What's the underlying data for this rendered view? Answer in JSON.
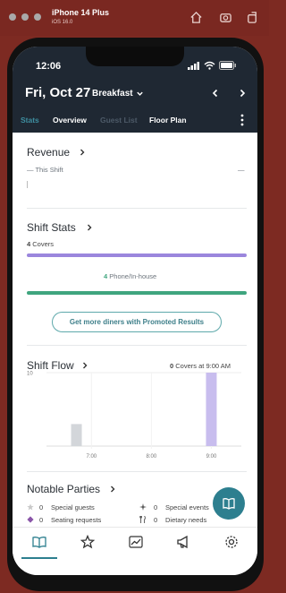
{
  "simulator": {
    "title": "iPhone 14 Plus",
    "subtitle": "iOS 16.0",
    "icons": [
      "home-icon",
      "screenshot-icon",
      "rotate-icon"
    ]
  },
  "status_bar": {
    "time": "12:06",
    "icons": [
      "signal-icon",
      "wifi-icon",
      "battery-icon"
    ]
  },
  "header": {
    "date": "Fri, Oct 27",
    "meal": "Breakfast",
    "prev_icon": "chevron-left-icon",
    "next_icon": "chevron-right-icon"
  },
  "tabs": [
    {
      "label": "Stats",
      "state": "active"
    },
    {
      "label": "Overview",
      "state": "normal"
    },
    {
      "label": "Guest List",
      "state": "dim"
    },
    {
      "label": "Floor Plan",
      "state": "normal"
    }
  ],
  "revenue": {
    "title": "Revenue",
    "legend": "— This Shift",
    "value": "—"
  },
  "shift_stats": {
    "title": "Shift Stats",
    "covers_count": "4",
    "covers_label": "Covers",
    "phone_count": "4",
    "phone_label": "Phone/In-house",
    "covers_bar_color": "#9b86dd",
    "phone_bar_color": "#3fa57e"
  },
  "promo": {
    "label": "Get more diners with Promoted Results"
  },
  "shift_flow": {
    "title": "Shift Flow",
    "summary_count": "0",
    "summary_label": "Covers at 9:00 AM"
  },
  "chart_data": {
    "type": "bar",
    "title": "Shift Flow",
    "x_ticks": [
      "7:00",
      "8:00",
      "9:00"
    ],
    "y_ticks": [
      "10"
    ],
    "bars": [
      {
        "x": "6:45",
        "value": 3,
        "color": "#d3d6da"
      },
      {
        "x": "9:00",
        "value": 10,
        "color": "#c8bdee"
      }
    ]
  },
  "notable_parties": {
    "title": "Notable Parties",
    "rows": [
      {
        "icon": "star-icon",
        "count": "0",
        "label": "Special guests"
      },
      {
        "icon": "sparkle-icon",
        "count": "0",
        "label": "Special events"
      },
      {
        "icon": "gift-icon",
        "count": "0",
        "label": "Seating requests"
      },
      {
        "icon": "utensils-icon",
        "count": "0",
        "label": "Dietary needs"
      }
    ]
  },
  "fab": {
    "icon": "book-icon"
  },
  "bottom_nav": [
    {
      "icon": "book-open-icon",
      "active": true
    },
    {
      "icon": "star-outline-icon",
      "active": false
    },
    {
      "icon": "trending-icon",
      "active": false
    },
    {
      "icon": "megaphone-icon",
      "active": false
    },
    {
      "icon": "settings-icon",
      "active": false
    }
  ]
}
